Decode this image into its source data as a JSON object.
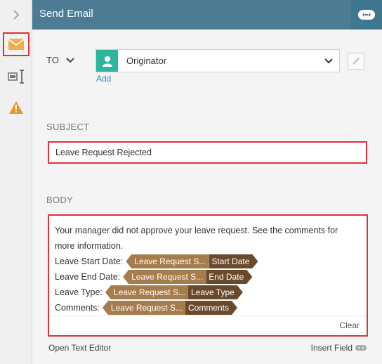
{
  "header": {
    "title": "Send Email"
  },
  "to": {
    "label": "TO",
    "value": "Originator",
    "add_label": "Add"
  },
  "subject": {
    "label": "SUBJECT",
    "value": "Leave Request Rejected"
  },
  "body": {
    "label": "BODY",
    "intro": "Your manager did not approve your leave request. See the comments for more information.",
    "rows": [
      {
        "label": "Leave Start Date:",
        "source": "Leave Request S...",
        "field": "Start Date"
      },
      {
        "label": "Leave End Date:",
        "source": "Leave Request S...",
        "field": "End Date"
      },
      {
        "label": "Leave Type:",
        "source": "Leave Request S...",
        "field": "Leave Type"
      },
      {
        "label": "Comments:",
        "source": "Leave Request S...",
        "field": "Comments"
      }
    ],
    "clear_label": "Clear"
  },
  "footer": {
    "open_text_editor": "Open Text Editor",
    "insert_field": "Insert Field"
  },
  "colors": {
    "header": "#4b7c93",
    "accent_red": "#e2323a",
    "token_source": "#a77c4c",
    "token_field": "#6b4a2b",
    "avatar": "#2fb4a0",
    "link": "#2a8bc0",
    "envelope": "#f0ad4e",
    "warning": "#e8962f"
  },
  "icons": [
    "chevron-right-icon",
    "envelope-icon",
    "text-cursor-icon",
    "warning-icon",
    "toggle-icon",
    "user-icon",
    "chevron-down-icon",
    "pencil-icon",
    "insert-field-icon"
  ]
}
